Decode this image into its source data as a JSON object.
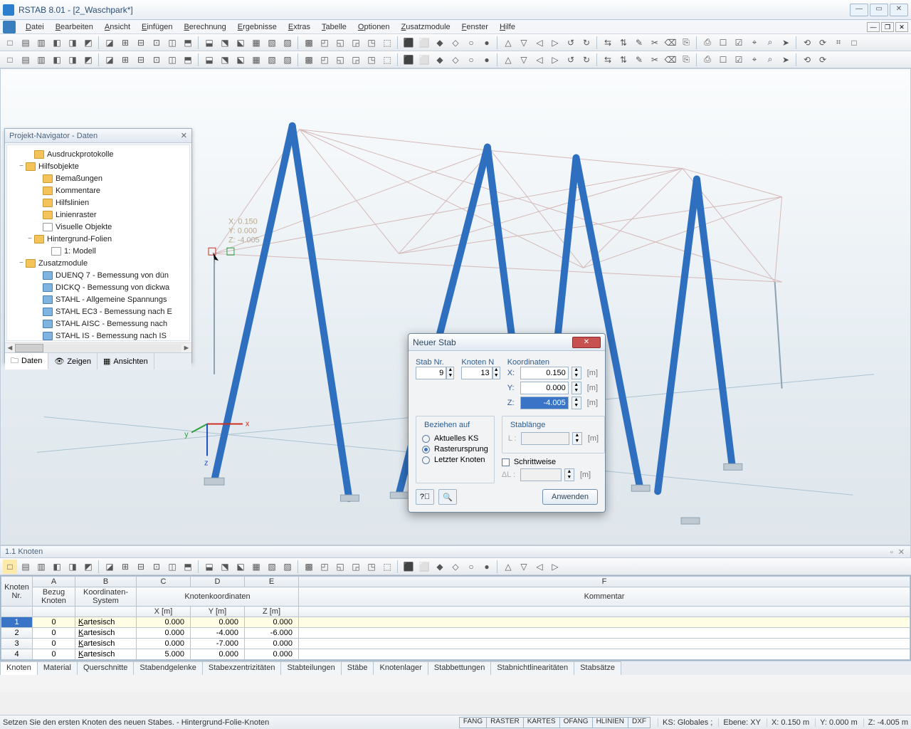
{
  "title": "RSTAB 8.01 - [2_Waschpark*]",
  "menu": [
    "Datei",
    "Bearbeiten",
    "Ansicht",
    "Einfügen",
    "Berechnung",
    "Ergebnisse",
    "Extras",
    "Tabelle",
    "Optionen",
    "Zusatzmodule",
    "Fenster",
    "Hilfe"
  ],
  "navigator": {
    "title": "Projekt-Navigator - Daten",
    "items": [
      {
        "indent": 24,
        "icon": "f",
        "label": "Ausdruckprotokolle"
      },
      {
        "indent": 12,
        "exp": "−",
        "icon": "f",
        "label": "Hilfsobjekte"
      },
      {
        "indent": 36,
        "icon": "f",
        "label": "Bemaßungen"
      },
      {
        "indent": 36,
        "icon": "f",
        "label": "Kommentare"
      },
      {
        "indent": 36,
        "icon": "f",
        "label": "Hilfslinien"
      },
      {
        "indent": 36,
        "icon": "f",
        "label": "Linienraster"
      },
      {
        "indent": 36,
        "icon": "d",
        "label": "Visuelle Objekte"
      },
      {
        "indent": 24,
        "exp": "−",
        "icon": "f",
        "label": "Hintergrund-Folien"
      },
      {
        "indent": 48,
        "icon": "d",
        "label": "1: Modell"
      },
      {
        "indent": 12,
        "exp": "−",
        "icon": "f",
        "label": "Zusatzmodule"
      },
      {
        "indent": 36,
        "icon": "m",
        "label": "DUENQ 7 - Bemessung von dün"
      },
      {
        "indent": 36,
        "icon": "m",
        "label": "DICKQ - Bemessung von dickwa"
      },
      {
        "indent": 36,
        "icon": "m",
        "label": "STAHL - Allgemeine Spannungs"
      },
      {
        "indent": 36,
        "icon": "m",
        "label": "STAHL EC3 - Bemessung nach E"
      },
      {
        "indent": 36,
        "icon": "m",
        "label": "STAHL AISC - Bemessung nach"
      },
      {
        "indent": 36,
        "icon": "m",
        "label": "STAHL IS - Bemessung nach IS"
      }
    ],
    "tabs": [
      "Daten",
      "Zeigen",
      "Ansichten"
    ]
  },
  "viewport": {
    "coords_label": "X:  0.150\nY:  0.000\nZ: -4.005",
    "axes": [
      "x",
      "y",
      "z"
    ]
  },
  "dialog": {
    "title": "Neuer Stab",
    "stab_label": "Stab Nr.",
    "stab_value": "9",
    "knoten_label": "Knoten N",
    "knoten_value": "13",
    "coord_label": "Koordinaten",
    "x_label": "X:",
    "x_value": "0.150",
    "y_label": "Y:",
    "y_value": "0.000",
    "z_label": "Z:",
    "z_value": "-4.005",
    "unit": "[m]",
    "bez_label": "Beziehen auf",
    "bez_opts": [
      "Aktuelles KS",
      "Rasterursprung",
      "Letzter Knoten"
    ],
    "bez_selected": 1,
    "stablange_label": "Stablänge",
    "L_label": "L :",
    "schritt_label": "Schrittweise",
    "dL_label": "ΔL :",
    "apply": "Anwenden"
  },
  "table": {
    "title": "1.1 Knoten",
    "col_letters": [
      "A",
      "B",
      "C",
      "D",
      "E",
      "F"
    ],
    "group_headers": {
      "nr": "Knoten\nNr.",
      "bezug": "Bezug\nKnoten",
      "system": "Koordinaten-\nSystem",
      "coord": "Knotenkoordinaten",
      "komm": "Kommentar"
    },
    "sub_headers": [
      "X [m]",
      "Y [m]",
      "Z [m]"
    ],
    "rows": [
      {
        "nr": "1",
        "bezug": "0",
        "sys": "Kartesisch",
        "x": "0.000",
        "y": "0.000",
        "z": "0.000",
        "k": ""
      },
      {
        "nr": "2",
        "bezug": "0",
        "sys": "Kartesisch",
        "x": "0.000",
        "y": "-4.000",
        "z": "-6.000",
        "k": ""
      },
      {
        "nr": "3",
        "bezug": "0",
        "sys": "Kartesisch",
        "x": "0.000",
        "y": "-7.000",
        "z": "0.000",
        "k": ""
      },
      {
        "nr": "4",
        "bezug": "0",
        "sys": "Kartesisch",
        "x": "5.000",
        "y": "0.000",
        "z": "0.000",
        "k": ""
      }
    ],
    "tabs": [
      "Knoten",
      "Material",
      "Querschnitte",
      "Stabendgelenke",
      "Stabexzentrizitäten",
      "Stabteilungen",
      "Stäbe",
      "Knotenlager",
      "Stabbettungen",
      "Stabnichtlinearitäten",
      "Stabsätze"
    ]
  },
  "status": {
    "message": "Setzen Sie den ersten Knoten des neuen Stabes. - Hintergrund-Folie-Knoten",
    "snap_buttons": [
      "FANG",
      "RASTER",
      "KARTES",
      "OFANG",
      "HLINIEN",
      "DXF"
    ],
    "info": [
      "KS: Globales ;",
      "Ebene: XY",
      "X: 0.150 m",
      "Y: 0.000 m",
      "Z: -4.005 m"
    ]
  }
}
